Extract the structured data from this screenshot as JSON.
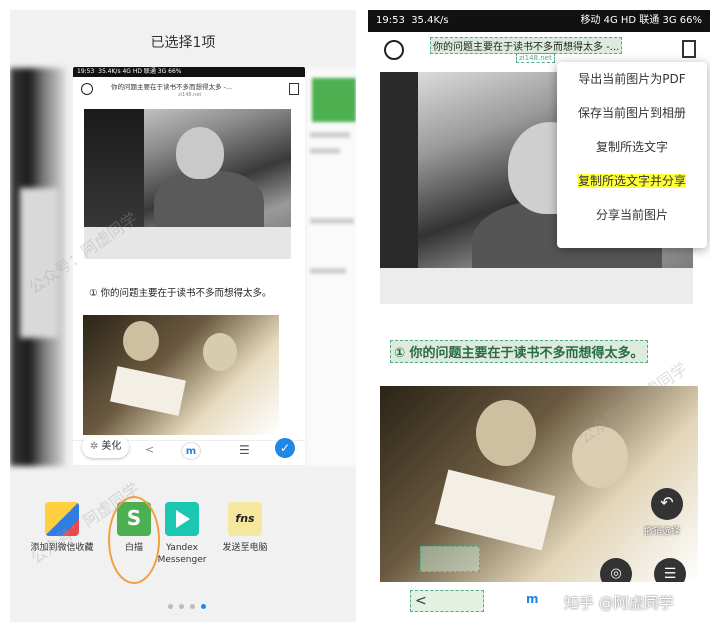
{
  "left": {
    "title": "已选择1项",
    "card": {
      "status_time": "19:53",
      "status_text": "35.4K/s  4G HD  联通 3G  66%",
      "title": "你的问题主要在于读书不多而想得太多 -...",
      "subtitle": "zi148.net",
      "body_text": "① 你的问题主要在于读书不多而想得太多。",
      "beautify_label": "美化",
      "back_glyph": "<",
      "m_glyph": "m",
      "menu_glyph": "☰",
      "check_glyph": "✓"
    },
    "share_items": [
      {
        "label": "添加到微信收藏",
        "icon": "cube-icon"
      },
      {
        "label": "白描",
        "icon": "baimiao-icon"
      },
      {
        "label": "Yandex Messenger",
        "icon": "yandex-icon"
      },
      {
        "label": "发送至电脑",
        "icon": "fns-icon",
        "icon_text": "fns"
      }
    ],
    "page_count": 4,
    "active_page": 4
  },
  "right": {
    "status_time": "19:53",
    "status_left": "35.4K/s",
    "status_right": "移动 4G HD  联通 3G  66%",
    "header_title": "你的问题主要在于读书不多而想得太多 -...",
    "header_sub": "zi148.net",
    "menu_icon_badge": "1",
    "context_menu": [
      "导出当前图片为PDF",
      "保存当前图片到相册",
      "复制所选文字",
      "复制所选文字并分享",
      "分享当前图片"
    ],
    "highlighted_index": 3,
    "body_text": "① 你的问题主要在于读书不多而想得太多。",
    "undo_label": "撤销选择",
    "back_glyph": "<",
    "m_glyph": "m",
    "watermark": "知乎 @阿虚同学"
  },
  "watermark_text": "公众号：阿虚同学",
  "colors": {
    "highlight": "#ffff3a",
    "selection_green": "#5aa888",
    "accent_blue": "#1e88e5",
    "oval": "#f0a040"
  }
}
